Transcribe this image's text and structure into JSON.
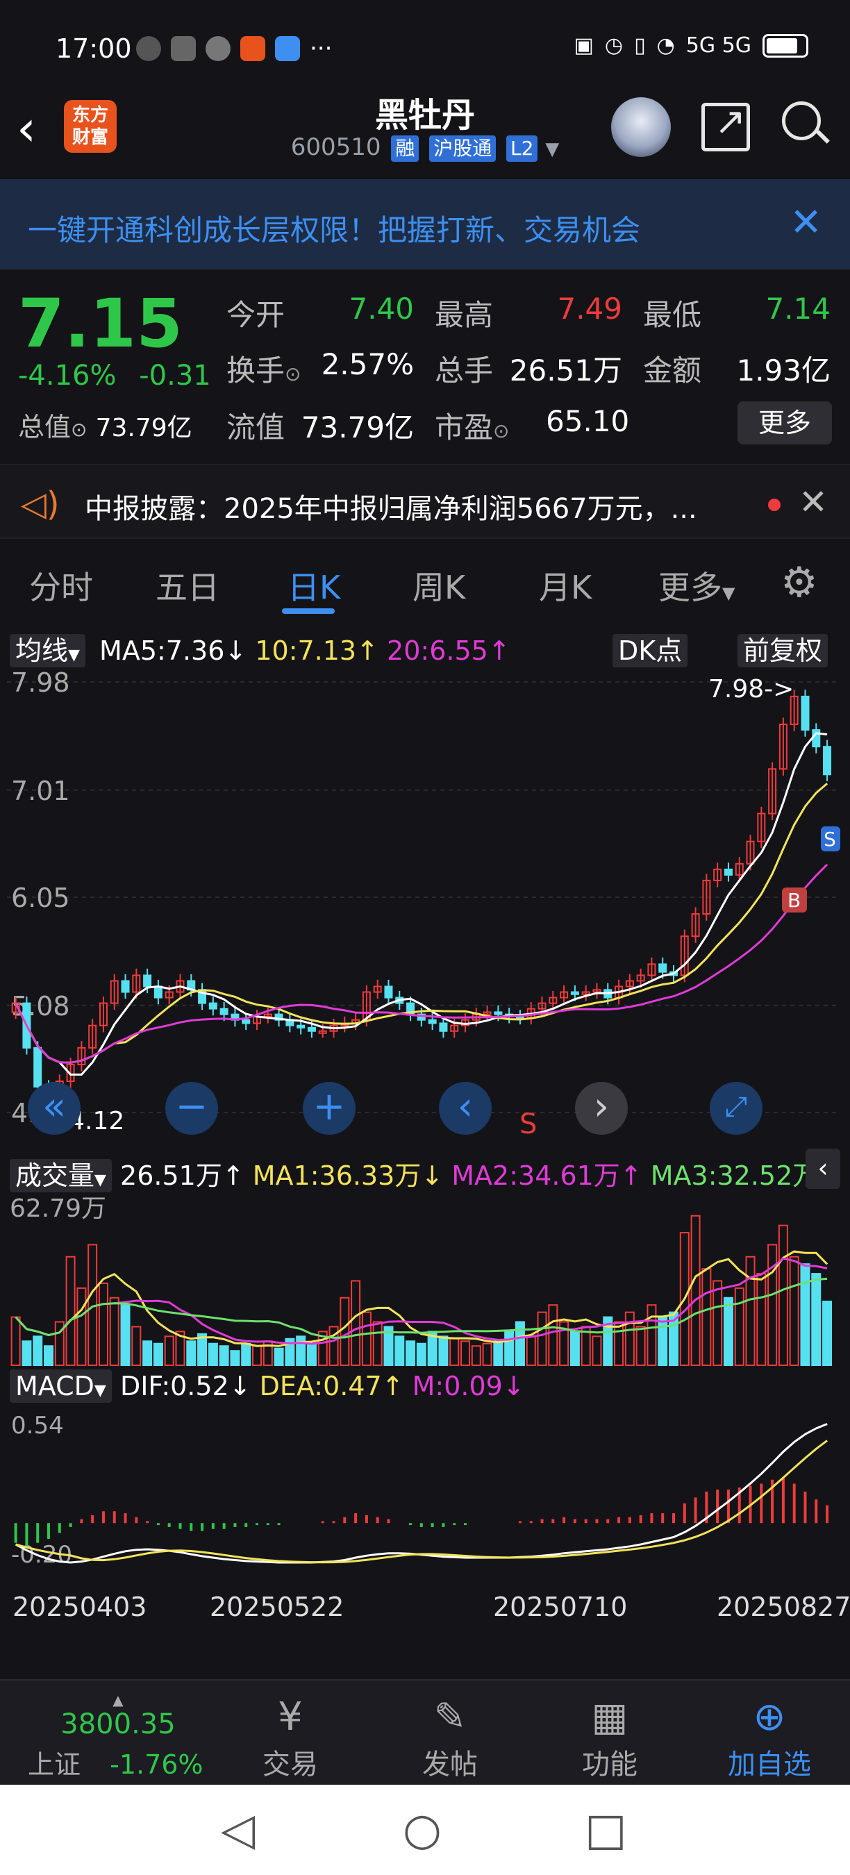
{
  "status_bar": {
    "time": "17:00",
    "right_text": "5G 5G"
  },
  "header": {
    "back_label": "‹",
    "logo_text_top": "东方",
    "logo_text_bottom": "财富",
    "title": "黑牡丹",
    "code": "600510",
    "tags": [
      "融",
      "沪股通",
      "L2"
    ]
  },
  "banner": {
    "text": "一键开通科创成长层权限！把握打新、交易机会",
    "close": "✕"
  },
  "quote": {
    "price": "7.15",
    "change_pct": "-4.16%",
    "change": "-0.31",
    "total_value_label": "总值",
    "total_value": "73.79亿",
    "fields": [
      {
        "label": "今开",
        "value": "7.40",
        "color": "green"
      },
      {
        "label": "最高",
        "value": "7.49",
        "color": "red"
      },
      {
        "label": "最低",
        "value": "7.14",
        "color": "green"
      },
      {
        "label": "换手",
        "value": "2.57%",
        "color": "white"
      },
      {
        "label": "总手",
        "value": "26.51万",
        "color": "white"
      },
      {
        "label": "金额",
        "value": "1.93亿",
        "color": "white"
      },
      {
        "label": "流值",
        "value": "73.79亿",
        "color": "white"
      },
      {
        "label": "市盈",
        "value": "65.10",
        "color": "white"
      }
    ],
    "more_label": "更多"
  },
  "notice": {
    "text": "中报披露：2025年中报归属净利润5667万元，..."
  },
  "tabs": [
    "分时",
    "五日",
    "日K",
    "周K",
    "月K",
    "更多"
  ],
  "active_tab": 2,
  "kline_legend": {
    "selector": "均线",
    "ma5": "MA5:7.36↓",
    "ma10": "10:7.13↑",
    "ma20": "20:6.55↑",
    "dk": "DK点",
    "adjust": "前复权"
  },
  "volume_legend": {
    "selector": "成交量",
    "vol": "26.51万↑",
    "ma1": "MA1:36.33万↓",
    "ma2": "MA2:34.61万↑",
    "ma3": "MA3:32.52万↑"
  },
  "macd_legend": {
    "selector": "MACD",
    "dif": "DIF:0.52↓",
    "dea": "DEA:0.47↑",
    "m": "M:0.09↓"
  },
  "colors": {
    "up": "#ef3b3b",
    "down": "#2fc74a",
    "accent": "#3d8ff2",
    "ma5": "#ffffff",
    "ma10": "#f3e35a",
    "ma20": "#e03bd6"
  },
  "chart_data": [
    {
      "type": "candlestick",
      "title": "日K",
      "y_ticks": [
        "7.98",
        "7.01",
        "6.05",
        "5.08",
        "4.12"
      ],
      "ylim": [
        4.12,
        7.98
      ],
      "high_annotation": "7.98->",
      "low_annotation": "<-4.12",
      "markers": [
        "B",
        "S"
      ],
      "close": [
        5.1,
        4.7,
        4.35,
        4.3,
        4.4,
        4.55,
        4.7,
        4.9,
        5.1,
        5.3,
        5.2,
        5.35,
        5.25,
        5.15,
        5.2,
        5.3,
        5.22,
        5.1,
        5.05,
        5.0,
        4.95,
        4.92,
        4.98,
        5.0,
        4.95,
        4.9,
        4.88,
        4.85,
        4.85,
        4.9,
        4.92,
        4.95,
        5.2,
        5.25,
        5.15,
        5.1,
        5.0,
        4.95,
        4.92,
        4.85,
        4.9,
        4.95,
        5.0,
        5.02,
        5.0,
        4.98,
        4.97,
        5.05,
        5.1,
        5.15,
        5.2,
        5.18,
        5.2,
        5.22,
        5.15,
        5.25,
        5.3,
        5.35,
        5.45,
        5.38,
        5.35,
        5.7,
        5.9,
        6.2,
        6.3,
        6.25,
        6.35,
        6.55,
        6.8,
        7.2,
        7.6,
        7.85,
        7.55,
        7.4,
        7.15
      ],
      "ma5_last": 7.36,
      "ma10_last": 7.13,
      "ma20_last": 6.55
    },
    {
      "type": "bar",
      "title": "成交量",
      "y_ticks": [
        "62.79万"
      ],
      "volume": [
        20,
        10,
        12,
        8,
        18,
        45,
        32,
        50,
        34,
        28,
        25,
        16,
        10,
        9,
        12,
        14,
        10,
        13,
        9,
        8,
        6,
        9,
        8,
        10,
        7,
        11,
        12,
        9,
        14,
        16,
        28,
        35,
        22,
        18,
        16,
        12,
        10,
        9,
        14,
        12,
        11,
        10,
        8,
        9,
        10,
        14,
        18,
        12,
        22,
        25,
        18,
        14,
        16,
        12,
        20,
        18,
        22,
        16,
        25,
        20,
        22,
        55,
        62,
        40,
        35,
        28,
        32,
        45,
        38,
        50,
        58,
        45,
        42,
        38,
        26.51
      ]
    },
    {
      "type": "bar",
      "title": "MACD",
      "y_ticks": [
        "0.54",
        "-0.20"
      ],
      "x_ticks": [
        "20250403",
        "20250522",
        "20250710",
        "20250827"
      ],
      "macd": [
        -0.1,
        -0.12,
        -0.1,
        -0.08,
        -0.05,
        -0.02,
        0.02,
        0.04,
        0.06,
        0.06,
        0.05,
        0.03,
        0.01,
        -0.01,
        -0.02,
        -0.03,
        -0.04,
        -0.04,
        -0.03,
        -0.03,
        -0.02,
        -0.02,
        -0.01,
        -0.01,
        -0.01,
        0.0,
        0.0,
        0.0,
        0.01,
        0.01,
        0.03,
        0.05,
        0.04,
        0.03,
        0.02,
        0.0,
        -0.01,
        -0.02,
        -0.02,
        -0.02,
        -0.01,
        -0.01,
        0.0,
        0.0,
        0.0,
        0.0,
        0.01,
        0.01,
        0.02,
        0.02,
        0.03,
        0.02,
        0.02,
        0.02,
        0.02,
        0.03,
        0.03,
        0.04,
        0.05,
        0.05,
        0.05,
        0.1,
        0.13,
        0.16,
        0.17,
        0.17,
        0.18,
        0.19,
        0.2,
        0.22,
        0.23,
        0.2,
        0.16,
        0.12,
        0.09
      ]
    }
  ],
  "bottom_bar": {
    "index_value": "3800.35",
    "index_name": "上证",
    "index_change": "-1.76%",
    "items": [
      "交易",
      "发帖",
      "功能",
      "加自选"
    ]
  }
}
